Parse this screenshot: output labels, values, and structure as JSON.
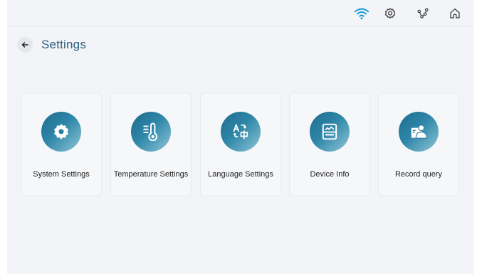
{
  "header": {
    "title": "Settings"
  },
  "topbar": {
    "icons": [
      "wifi-icon",
      "gear-icon",
      "network-icon",
      "home-icon"
    ],
    "wifi_color": "#1e9bd7"
  },
  "menu": {
    "items": [
      {
        "label": "System Settings",
        "icon": "gear-icon"
      },
      {
        "label": "Temperature Settings",
        "icon": "thermometer-icon"
      },
      {
        "label": "Language Settings",
        "icon": "translate-icon"
      },
      {
        "label": "Device Info",
        "icon": "device-info-icon"
      },
      {
        "label": "Record query",
        "icon": "record-query-icon"
      }
    ]
  },
  "colors": {
    "accent": "#2e86a8",
    "title": "#2e5d7e",
    "background": "#f3f4f7"
  }
}
